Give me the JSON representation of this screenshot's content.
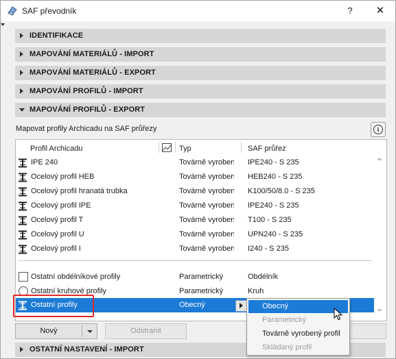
{
  "window": {
    "title": "SAF převodník",
    "help_label": "?",
    "close_label": "✕"
  },
  "sections": [
    {
      "label": "IDENTIFIKACE",
      "expanded": false
    },
    {
      "label": "MAPOVÁNÍ MATERIÁLŮ - IMPORT",
      "expanded": false
    },
    {
      "label": "MAPOVÁNÍ MATERIÁLŮ - EXPORT",
      "expanded": false
    },
    {
      "label": "MAPOVÁNÍ PROFILŮ - IMPORT",
      "expanded": false
    },
    {
      "label": "MAPOVÁNÍ PROFILŮ - EXPORT",
      "expanded": true
    }
  ],
  "export_profiles": {
    "description": "Mapovat profily Archicadu na SAF průřezy",
    "info_label": "i",
    "columns": {
      "profile": "Profil Archicadu",
      "type": "Typ",
      "saf": "SAF průřez"
    },
    "rows": [
      {
        "icon": "i-beam-icon",
        "profile": "IPE 240",
        "type": "Továrně vyrobený",
        "saf": "IPE240 - S 235"
      },
      {
        "icon": "i-beam-icon",
        "profile": "Ocelový profil HEB",
        "type": "Továrně vyrobený",
        "saf": "HEB240 - S 235"
      },
      {
        "icon": "i-beam-icon",
        "profile": "Ocelový profil hranatá trubka",
        "type": "Továrně vyrobený",
        "saf": "K100/50/8.0 - S 235"
      },
      {
        "icon": "i-beam-icon",
        "profile": "Ocelový profil IPE",
        "type": "Továrně vyrobený",
        "saf": "IPE240 - S 235"
      },
      {
        "icon": "i-beam-icon",
        "profile": "Ocelový profil T",
        "type": "Továrně vyrobený",
        "saf": "T100 - S 235"
      },
      {
        "icon": "i-beam-icon",
        "profile": "Ocelový profil U",
        "type": "Továrně vyrobený",
        "saf": "UPN240 - S 235"
      },
      {
        "icon": "i-beam-icon",
        "profile": "Ocelový profil I",
        "type": "Továrně vyrobený",
        "saf": "I240 - S 235"
      }
    ],
    "other_rows": [
      {
        "icon": "square-icon",
        "profile": "Ostatní obdélníkové profily",
        "type": "Parametrický",
        "saf": "Obdélník"
      },
      {
        "icon": "circle-icon",
        "profile": "Ostatní kruhové profily",
        "type": "Parametrický",
        "saf": "Kruh"
      },
      {
        "icon": "i-beam-icon",
        "profile": "Ostatní profily",
        "type": "Obecný",
        "saf": "",
        "selected": true
      }
    ],
    "type_options": [
      {
        "label": "Obecný",
        "state": "highlighted"
      },
      {
        "label": "Parametrický",
        "state": "disabled"
      },
      {
        "label": "Továrně vyrobený profil",
        "state": "enabled"
      },
      {
        "label": "Skládaný profil",
        "state": "disabled"
      }
    ]
  },
  "buttons": {
    "new_label": "Nový",
    "remove_label": "Odstranit"
  },
  "bottom_section": {
    "label": "OSTATNÍ NASTAVENÍ - IMPORT",
    "expanded": false
  }
}
